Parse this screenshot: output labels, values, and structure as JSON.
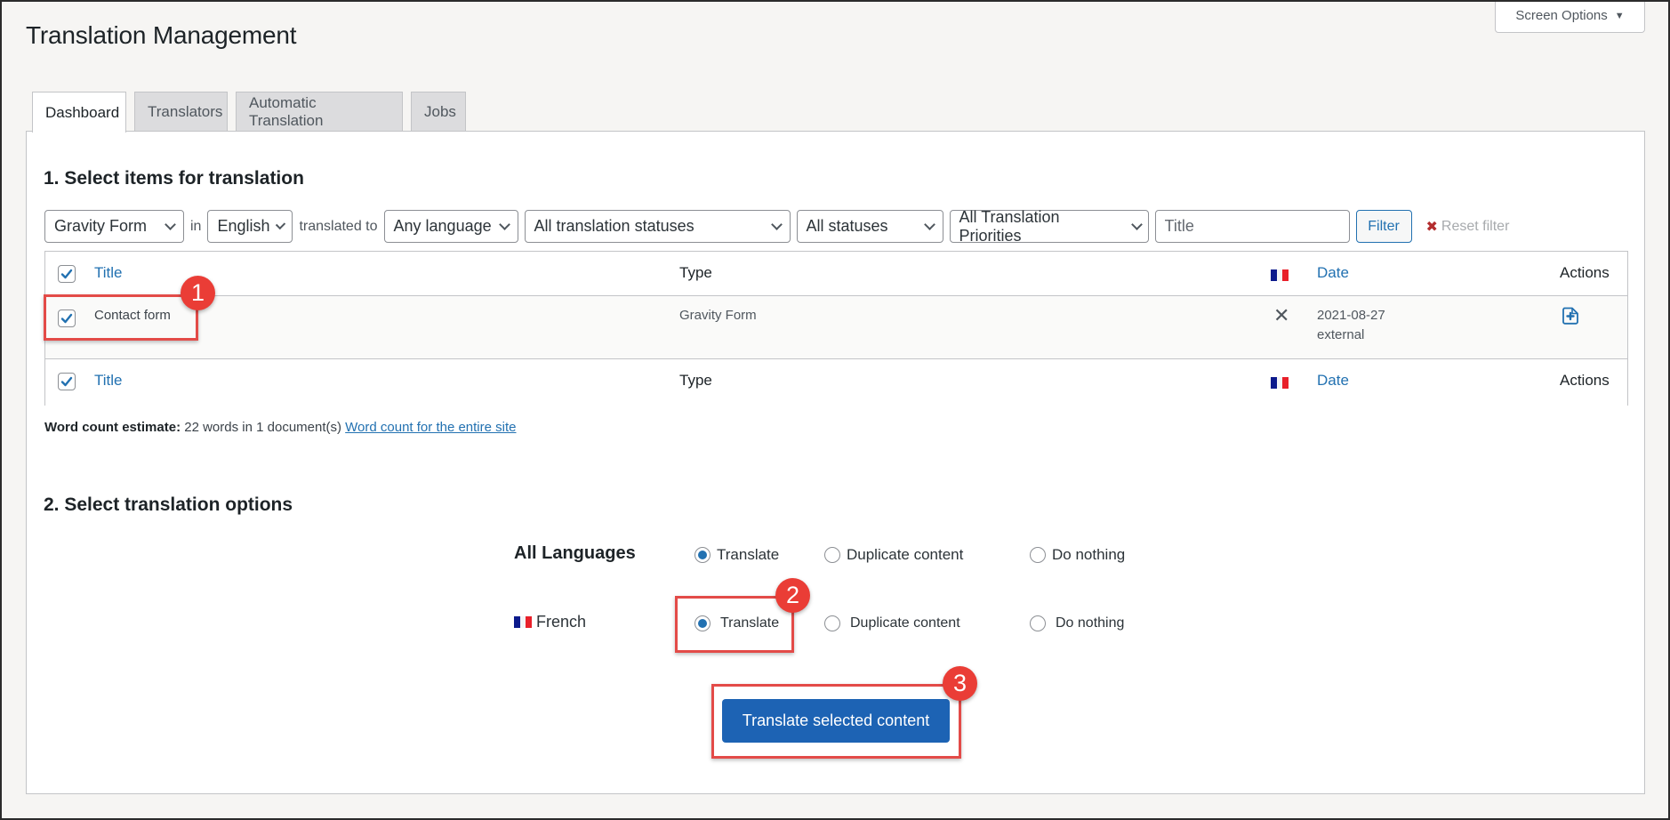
{
  "page": {
    "title": "Translation Management",
    "screen_options": "Screen Options"
  },
  "tabs": [
    {
      "label": "Dashboard",
      "active": true
    },
    {
      "label": "Translators",
      "active": false
    },
    {
      "label": "Automatic Translation",
      "active": false
    },
    {
      "label": "Jobs",
      "active": false
    }
  ],
  "section1": {
    "heading": "1. Select items for translation",
    "filters": {
      "type": "Gravity Form",
      "in_label": "in",
      "from_language": "English",
      "translated_to_label": "translated to",
      "to_language": "Any language",
      "translation_status": "All translation statuses",
      "status": "All statuses",
      "priority": "All Translation Priorities",
      "title_placeholder": "Title",
      "title_value": "",
      "filter_button": "Filter",
      "reset_filter": "Reset filter"
    },
    "table": {
      "columns": {
        "title": "Title",
        "type": "Type",
        "language_flag": "french-flag",
        "date": "Date",
        "actions": "Actions"
      },
      "select_all_checked": true,
      "rows": [
        {
          "checked": true,
          "title": "Contact form",
          "type": "Gravity Form",
          "translation_status": "not-translated",
          "status_icon": "x-icon",
          "date": "2021-08-27",
          "date_note": "external",
          "action_icon": "add-translation-icon"
        }
      ]
    },
    "word_count": {
      "label": "Word count estimate:",
      "value": "22 words in 1 document(s)",
      "link": "Word count for the entire site"
    }
  },
  "section2": {
    "heading": "2. Select translation options",
    "all_languages": {
      "label": "All Languages",
      "options": [
        "Translate",
        "Duplicate content",
        "Do nothing"
      ],
      "selected": "Translate"
    },
    "languages": [
      {
        "label": "French",
        "flag": "french-flag",
        "options": [
          "Translate",
          "Duplicate content",
          "Do nothing"
        ],
        "selected": "Translate"
      }
    ],
    "submit_button": "Translate selected content"
  },
  "annotations": [
    "1",
    "2",
    "3"
  ],
  "colors": {
    "accent": "#2271b1",
    "primary_button": "#1d63b4",
    "annotation": "#ea3d36",
    "status_not_translated": "#e3a100"
  }
}
